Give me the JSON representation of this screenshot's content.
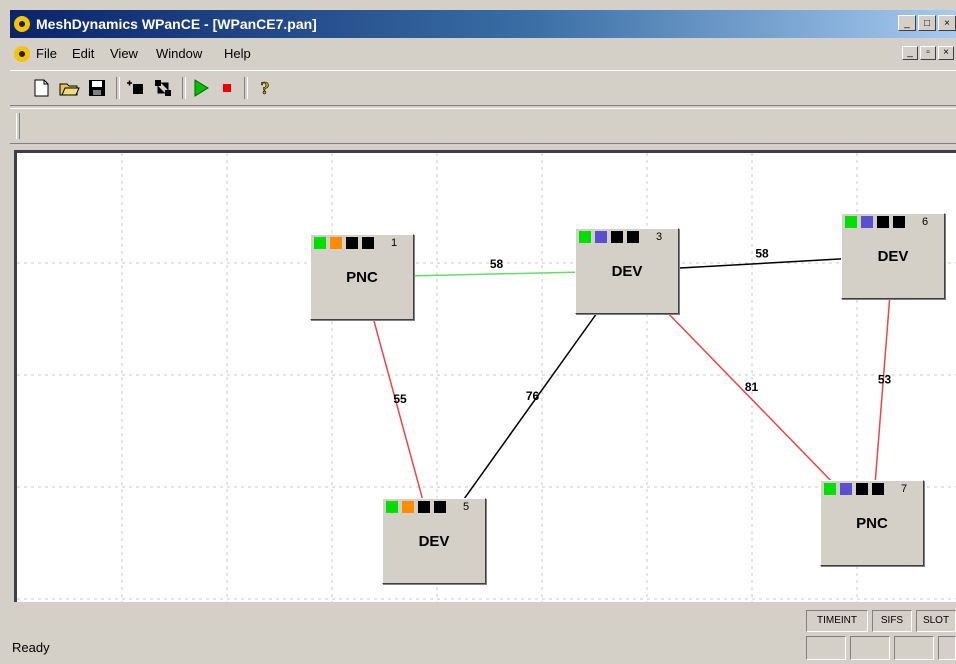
{
  "window": {
    "title": "MeshDynamics WPanCE - [WPanCE7.pan]"
  },
  "menu": [
    "File",
    "Edit",
    "View",
    "Window",
    "Help"
  ],
  "toolbar": {
    "icons": [
      "new-file-icon",
      "open-folder-icon",
      "save-icon",
      "add-node-icon",
      "connect-nodes-icon",
      "play-icon",
      "stop-icon",
      "help-icon"
    ]
  },
  "nodes": [
    {
      "id": "1",
      "label": "PNC",
      "indicators": [
        "#00e000",
        "#ff8c00",
        "#000000",
        "#000000"
      ]
    },
    {
      "id": "3",
      "label": "DEV",
      "indicators": [
        "#00e000",
        "#5a4fd0",
        "#000000",
        "#000000"
      ]
    },
    {
      "id": "6",
      "label": "DEV",
      "indicators": [
        "#00e000",
        "#5a4fd0",
        "#000000",
        "#000000"
      ]
    },
    {
      "id": "5",
      "label": "DEV",
      "indicators": [
        "#00e000",
        "#ff8c00",
        "#000000",
        "#000000"
      ]
    },
    {
      "id": "7",
      "label": "PNC",
      "indicators": [
        "#00e000",
        "#5a4fd0",
        "#000000",
        "#000000"
      ]
    }
  ],
  "edges": [
    {
      "from": "1",
      "to": "3",
      "label": "58",
      "color": "#66dd66"
    },
    {
      "from": "3",
      "to": "6",
      "label": "58",
      "color": "#000000"
    },
    {
      "from": "1",
      "to": "5",
      "label": "55",
      "color": "#ee4444"
    },
    {
      "from": "3",
      "to": "5",
      "label": "76",
      "color": "#000000"
    },
    {
      "from": "3",
      "to": "7",
      "label": "81",
      "color": "#ee4444"
    },
    {
      "from": "6",
      "to": "7",
      "label": "53",
      "color": "#ee4444"
    }
  ],
  "status": {
    "text": "Ready",
    "indicators": [
      "TIMEINT",
      "SIFS",
      "SLOT"
    ]
  }
}
